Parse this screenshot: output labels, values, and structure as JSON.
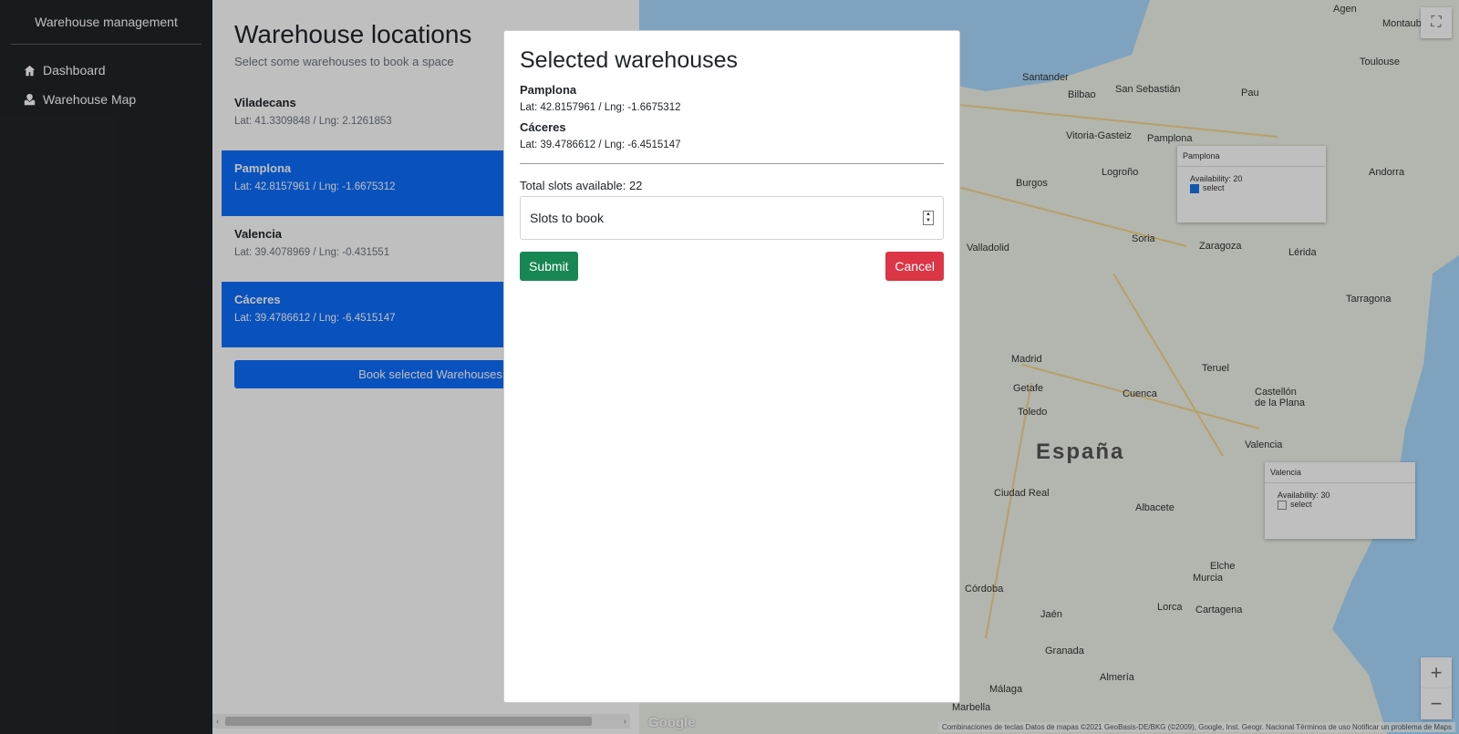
{
  "sidebar": {
    "brand": "Warehouse management",
    "items": [
      {
        "label": "Dashboard",
        "icon": "home-icon"
      },
      {
        "label": "Warehouse Map",
        "icon": "map-icon"
      }
    ]
  },
  "content": {
    "title": "Warehouse locations",
    "subtitle": "Select some warehouses to book a space",
    "warehouses": [
      {
        "name": "Viladecans",
        "coords": "Lat: 41.3309848 / Lng: 2.1261853",
        "selected": false
      },
      {
        "name": "Pamplona",
        "coords": "Lat: 42.8157961 / Lng: -1.6675312",
        "selected": true
      },
      {
        "name": "Valencia",
        "coords": "Lat: 39.4078969 / Lng: -0.431551",
        "selected": false
      },
      {
        "name": "Cáceres",
        "coords": "Lat: 39.4786612 / Lng: -6.4515147",
        "selected": true
      }
    ],
    "book_button": "Book selected Warehouses"
  },
  "map": {
    "country_label": "España",
    "cities": [
      "Bilbao",
      "San Sebastián",
      "Vitoria-Gasteiz",
      "Pamplona",
      "Burgos",
      "Logroño",
      "Valladolid",
      "Zaragoza",
      "Madrid",
      "Getafe",
      "Toledo",
      "Cuenca",
      "Teruel",
      "Valencia",
      "Albacete",
      "Murcia",
      "Córdoba",
      "Jaén",
      "Granada",
      "Málaga",
      "Almería",
      "Cartagena",
      "Toulouse",
      "Andorra",
      "Lérida",
      "Tarragona",
      "Santander",
      "Soria",
      "Castellón de la Plana",
      "Ciudad Real",
      "Elche",
      "Lorca",
      "Marbella",
      "Pau",
      "Agen",
      "Montauban"
    ],
    "infoboxes": [
      {
        "title": "Pamplona",
        "availability": "Availability: 20",
        "check": "select",
        "checked": true
      },
      {
        "title": "Valencia",
        "availability": "Availability: 30",
        "check": "select",
        "checked": false
      }
    ],
    "attribution": "Combinaciones de teclas   Datos de mapas ©2021 GeoBasis-DE/BKG (©2009), Google, Inst. Geogr. Nacional   Términos de uso   Notificar un problema de Maps",
    "google": "Google",
    "zoom_in": "+",
    "zoom_out": "−"
  },
  "modal": {
    "title": "Selected warehouses",
    "selected": [
      {
        "name": "Pamplona",
        "coords": "Lat: 42.8157961 / Lng: -1.6675312"
      },
      {
        "name": "Cáceres",
        "coords": "Lat: 39.4786612 / Lng: -6.4515147"
      }
    ],
    "total_slots": "Total slots available: 22",
    "slots_placeholder": "Slots to book",
    "submit_label": "Submit",
    "cancel_label": "Cancel"
  },
  "colors": {
    "primary": "#0d6efd",
    "success": "#198754",
    "danger": "#dc3545",
    "sidebar": "#212529"
  }
}
